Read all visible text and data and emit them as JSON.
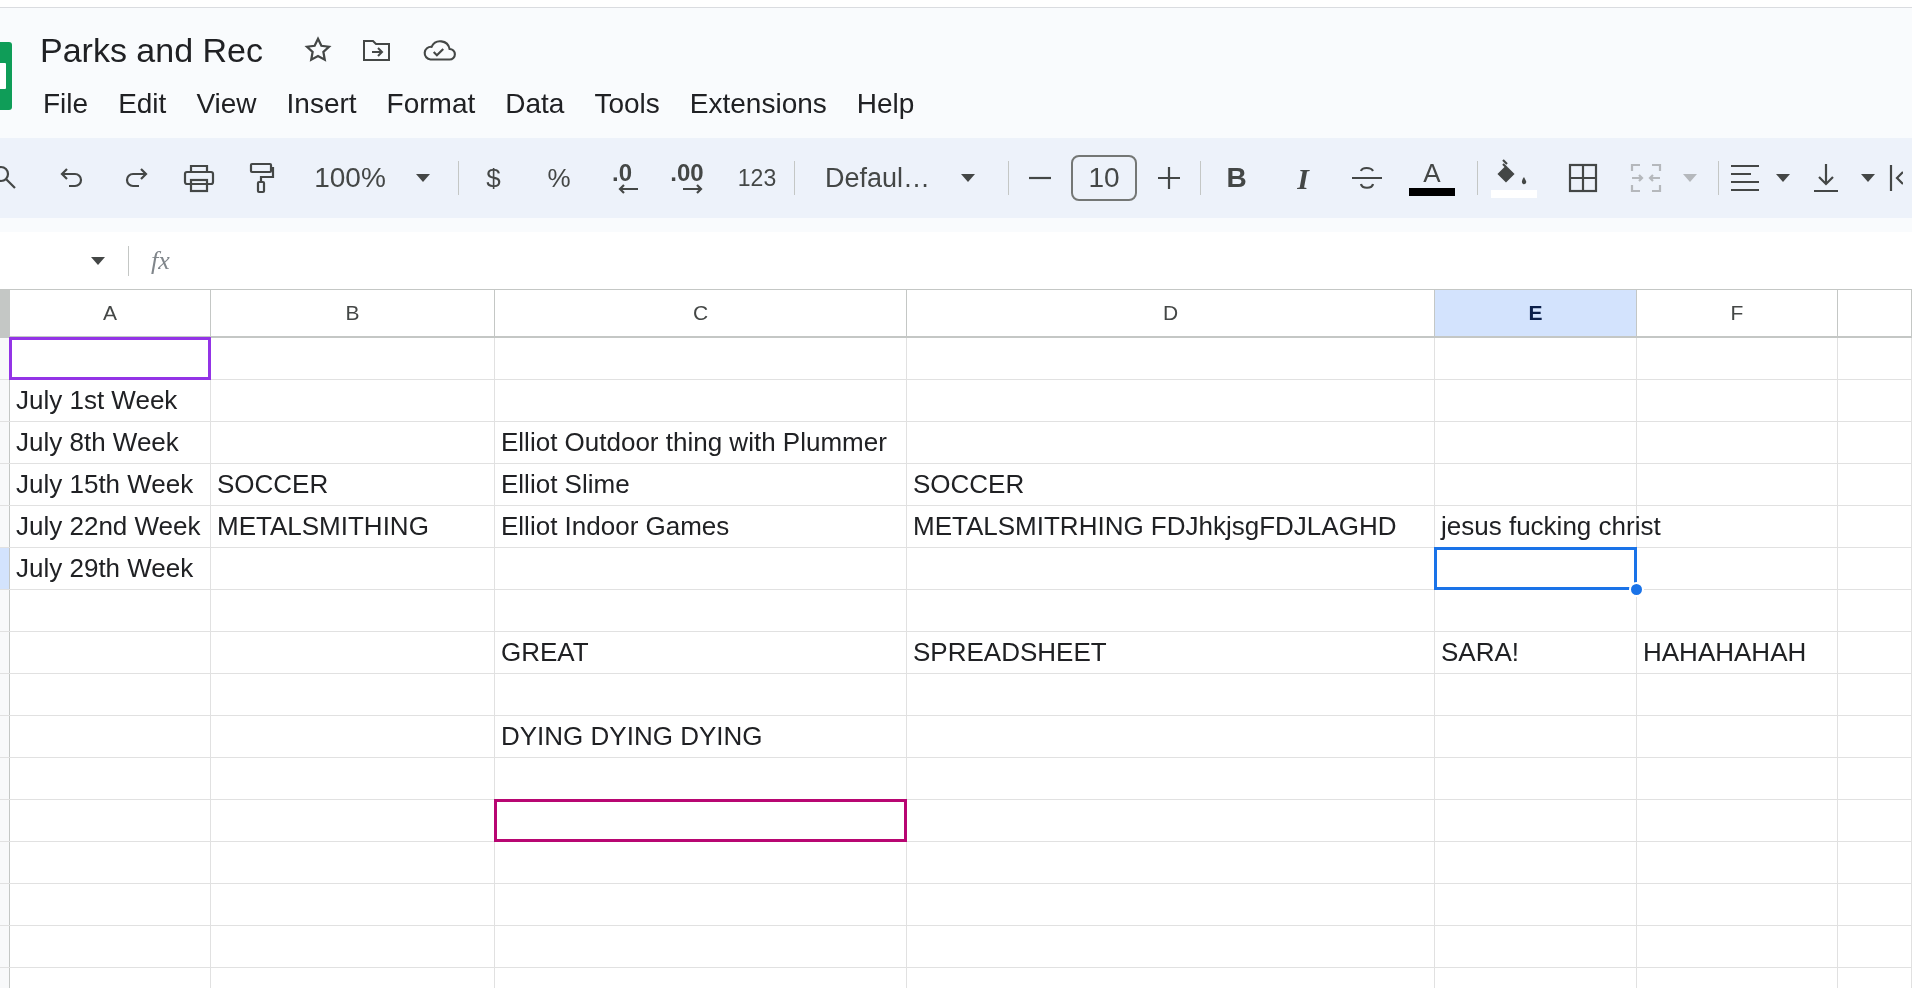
{
  "document": {
    "title": "Parks and Rec"
  },
  "menu": [
    "File",
    "Edit",
    "View",
    "Insert",
    "Format",
    "Data",
    "Tools",
    "Extensions",
    "Help"
  ],
  "toolbar": {
    "zoom": "100%",
    "currency": "$",
    "percent": "%",
    "decrease_decimals": ".0",
    "increase_decimals": ".00",
    "number_format": "123",
    "font": "Defaul…",
    "font_size": "10",
    "bold": "B",
    "italic": "I",
    "text_color": "A"
  },
  "formula_bar": {
    "fx": "fx"
  },
  "grid": {
    "columns": [
      {
        "label": "A",
        "selected": false
      },
      {
        "label": "B",
        "selected": false
      },
      {
        "label": "C",
        "selected": false
      },
      {
        "label": "D",
        "selected": false
      },
      {
        "label": "E",
        "selected": true
      },
      {
        "label": "F",
        "selected": false
      }
    ],
    "rows": [
      {
        "selected": false,
        "cells": [
          {
            "text": "",
            "outline": {
              "kind": "collaborator",
              "color": "#9334e6"
            }
          },
          "",
          "",
          "",
          "",
          ""
        ]
      },
      {
        "selected": false,
        "cells": [
          "July 1st Week",
          "",
          "",
          "",
          "",
          ""
        ]
      },
      {
        "selected": false,
        "cells": [
          "July 8th Week",
          "",
          "Elliot Outdoor thing with Plummer",
          "",
          "",
          ""
        ]
      },
      {
        "selected": false,
        "cells": [
          "July 15th Week",
          "SOCCER",
          "Elliot Slime",
          "SOCCER",
          "",
          ""
        ]
      },
      {
        "selected": false,
        "cells": [
          "July 22nd Week",
          "METALSMITHING",
          "Elliot Indoor Games",
          "METALSMITRHING FDJhkjsgFDJLAGHD",
          "jesus fucking christ",
          ""
        ]
      },
      {
        "selected": true,
        "cells": [
          "July 29th Week",
          "",
          "",
          "",
          {
            "text": "",
            "outline": {
              "kind": "selection",
              "color": "#1a73e8"
            }
          },
          ""
        ]
      },
      {
        "selected": false,
        "cells": [
          "",
          "",
          "",
          "",
          "",
          ""
        ]
      },
      {
        "selected": false,
        "cells": [
          "",
          "",
          "GREAT",
          "SPREADSHEET",
          "SARA!",
          "HAHAHAHAH"
        ]
      },
      {
        "selected": false,
        "cells": [
          "",
          "",
          "",
          "",
          "",
          ""
        ]
      },
      {
        "selected": false,
        "cells": [
          "",
          "",
          "DYING DYING DYING",
          "",
          "",
          ""
        ]
      },
      {
        "selected": false,
        "cells": [
          "",
          "",
          "",
          "",
          "",
          ""
        ]
      },
      {
        "selected": false,
        "cells": [
          "",
          "",
          {
            "text": "",
            "outline": {
              "kind": "collaborator",
              "color": "#b80672"
            }
          },
          "",
          "",
          ""
        ]
      },
      {
        "selected": false,
        "cells": [
          "",
          "",
          "",
          "",
          "",
          ""
        ]
      },
      {
        "selected": false,
        "cells": [
          "",
          "",
          "",
          "",
          "",
          ""
        ]
      },
      {
        "selected": false,
        "cells": [
          "",
          "",
          "",
          "",
          "",
          ""
        ]
      },
      {
        "selected": false,
        "cells": [
          "",
          "",
          "",
          "",
          "",
          ""
        ]
      }
    ]
  }
}
